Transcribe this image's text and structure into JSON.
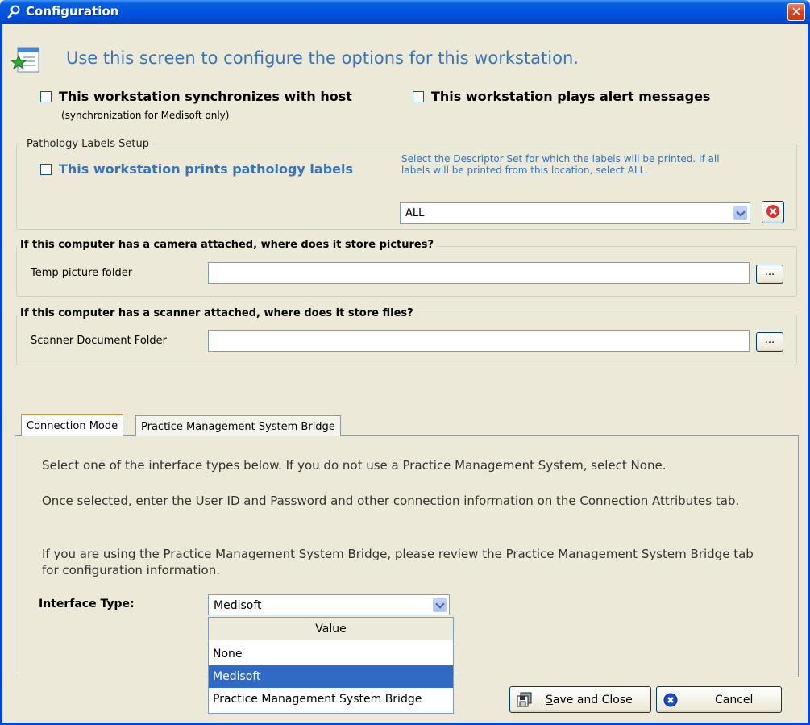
{
  "window": {
    "title": "Configuration",
    "close_glyph": "✕"
  },
  "header": {
    "text": "Use this screen to configure the options for this workstation."
  },
  "sync": {
    "label": "This workstation synchronizes with host",
    "note": "(synchronization for Medisoft only)"
  },
  "alerts": {
    "label": "This workstation plays alert messages"
  },
  "pathology": {
    "legend": "Pathology Labels Setup",
    "label": "This workstation prints pathology labels",
    "instructions": "Select the Descriptor Set for which the labels will be printed.  If all labels will be printed from this location, select ALL.",
    "selected": "ALL"
  },
  "camera": {
    "legend": "If this computer has a camera attached, where does it store pictures?",
    "label": "Temp picture folder",
    "value": "",
    "browse": "..."
  },
  "scanner": {
    "legend": "If this computer has a scanner attached, where does it store files?",
    "label": "Scanner Document Folder",
    "value": "",
    "browse": "..."
  },
  "tabs": [
    {
      "label": "Connection Mode"
    },
    {
      "label": "Practice Management System Bridge"
    }
  ],
  "connection": {
    "p1": "Select one of the interface types below.  If you do not use a Practice Management System, select None.",
    "p2": "Once selected, enter the User ID and Password and other connection information on the Connection Attributes tab.",
    "p3": "If you are using the Practice Management System Bridge, please review the Practice Management System Bridge tab for configuration information.",
    "interface_label": "Interface Type:",
    "interface_value": "Medisoft",
    "dropdown_header": "Value",
    "options": [
      "None",
      "Medisoft",
      "Practice Management System Bridge"
    ]
  },
  "footer": {
    "save_mnemonic": "S",
    "save_rest": "ave and Close",
    "cancel": "Cancel"
  },
  "colors": {
    "title_bar": "#0054e3",
    "accent_text": "#3a74b4",
    "selected_row": "#316ac5"
  }
}
